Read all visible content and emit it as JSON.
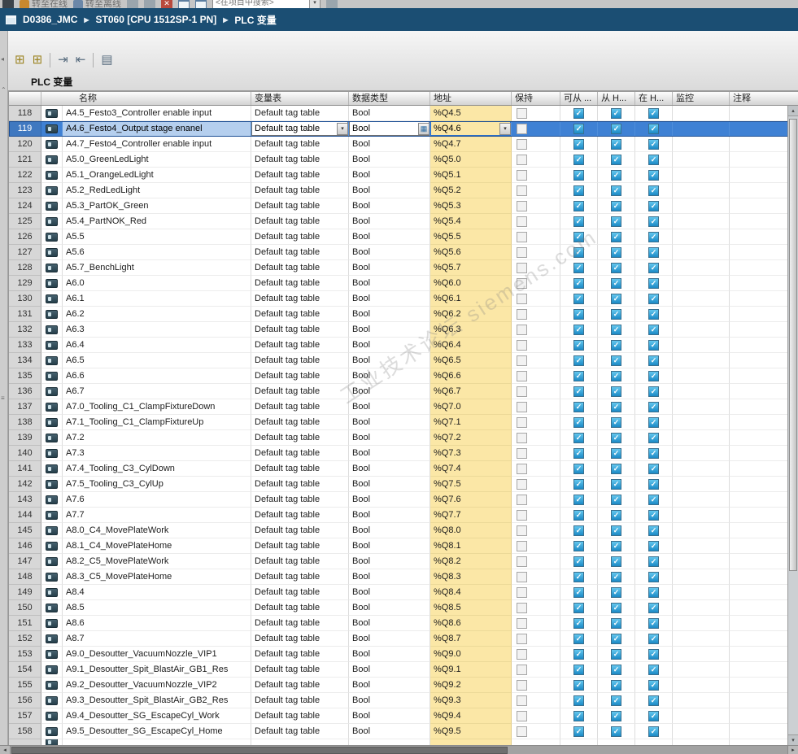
{
  "topbar": {
    "go_online": "转至在线",
    "go_offline": "转至离线",
    "search_placeholder": "<在项目中搜索>"
  },
  "breadcrumb": {
    "project": "D0386_JMC",
    "device": "ST060 [CPU 1512SP-1 PN]",
    "page": "PLC 变量"
  },
  "page": {
    "title": "PLC 变量"
  },
  "watermark": {
    "text": "工业技术论坛 siemens.com"
  },
  "colors": {
    "selection": "#3f81d4",
    "address_bg": "#fbe7a6",
    "checkbox": "#1b8ac6",
    "breadcrumb_bg": "#1b4e73"
  },
  "table": {
    "headers": {
      "name": "名称",
      "tag_table": "变量表",
      "data_type": "数据类型",
      "address": "地址",
      "retain": "保持",
      "acc": "可从 ...",
      "from_hmi": "从 H...",
      "in_hmi": "在 H...",
      "monitor": "监控",
      "comment": "注释"
    },
    "defaults": {
      "tag_table": "Default tag table",
      "data_type": "Bool",
      "retain": false,
      "acc": true,
      "from_hmi": true,
      "in_hmi": true,
      "selected": false,
      "comment": ""
    },
    "rows": [
      {
        "num": 118,
        "name": "A4.5_Festo3_Controller enable input",
        "address": "%Q4.5"
      },
      {
        "num": 119,
        "name": "A4.6_Festo4_Output stage enanel",
        "address": "%Q4.6",
        "selected": true
      },
      {
        "num": 120,
        "name": "A4.7_Festo4_Controller enable input",
        "address": "%Q4.7"
      },
      {
        "num": 121,
        "name": "A5.0_GreenLedLight",
        "address": "%Q5.0"
      },
      {
        "num": 122,
        "name": "A5.1_OrangeLedLight",
        "address": "%Q5.1"
      },
      {
        "num": 123,
        "name": "A5.2_RedLedLight",
        "address": "%Q5.2"
      },
      {
        "num": 124,
        "name": "A5.3_PartOK_Green",
        "address": "%Q5.3"
      },
      {
        "num": 125,
        "name": "A5.4_PartNOK_Red",
        "address": "%Q5.4"
      },
      {
        "num": 126,
        "name": "A5.5",
        "address": "%Q5.5"
      },
      {
        "num": 127,
        "name": "A5.6",
        "address": "%Q5.6"
      },
      {
        "num": 128,
        "name": "A5.7_BenchLight",
        "address": "%Q5.7"
      },
      {
        "num": 129,
        "name": "A6.0",
        "address": "%Q6.0"
      },
      {
        "num": 130,
        "name": "A6.1",
        "address": "%Q6.1"
      },
      {
        "num": 131,
        "name": "A6.2",
        "address": "%Q6.2"
      },
      {
        "num": 132,
        "name": "A6.3",
        "address": "%Q6.3"
      },
      {
        "num": 133,
        "name": "A6.4",
        "address": "%Q6.4"
      },
      {
        "num": 134,
        "name": "A6.5",
        "address": "%Q6.5"
      },
      {
        "num": 135,
        "name": "A6.6",
        "address": "%Q6.6"
      },
      {
        "num": 136,
        "name": "A6.7",
        "address": "%Q6.7"
      },
      {
        "num": 137,
        "name": "A7.0_Tooling_C1_ClampFixtureDown",
        "address": "%Q7.0"
      },
      {
        "num": 138,
        "name": "A7.1_Tooling_C1_ClampFixtureUp",
        "address": "%Q7.1"
      },
      {
        "num": 139,
        "name": "A7.2",
        "address": "%Q7.2"
      },
      {
        "num": 140,
        "name": "A7.3",
        "address": "%Q7.3"
      },
      {
        "num": 141,
        "name": "A7.4_Tooling_C3_CylDown",
        "address": "%Q7.4"
      },
      {
        "num": 142,
        "name": "A7.5_Tooling_C3_CylUp",
        "address": "%Q7.5"
      },
      {
        "num": 143,
        "name": "A7.6",
        "address": "%Q7.6"
      },
      {
        "num": 144,
        "name": "A7.7",
        "address": "%Q7.7"
      },
      {
        "num": 145,
        "name": "A8.0_C4_MovePlateWork",
        "address": "%Q8.0"
      },
      {
        "num": 146,
        "name": "A8.1_C4_MovePlateHome",
        "address": "%Q8.1"
      },
      {
        "num": 147,
        "name": "A8.2_C5_MovePlateWork",
        "address": "%Q8.2"
      },
      {
        "num": 148,
        "name": "A8.3_C5_MovePlateHome",
        "address": "%Q8.3"
      },
      {
        "num": 149,
        "name": "A8.4",
        "address": "%Q8.4"
      },
      {
        "num": 150,
        "name": "A8.5",
        "address": "%Q8.5"
      },
      {
        "num": 151,
        "name": "A8.6",
        "address": "%Q8.6"
      },
      {
        "num": 152,
        "name": "A8.7",
        "address": "%Q8.7"
      },
      {
        "num": 153,
        "name": "A9.0_Desoutter_VacuumNozzle_VIP1",
        "address": "%Q9.0"
      },
      {
        "num": 154,
        "name": "A9.1_Desoutter_Spit_BlastAir_GB1_Res",
        "address": "%Q9.1"
      },
      {
        "num": 155,
        "name": "A9.2_Desoutter_VacuumNozzle_VIP2",
        "address": "%Q9.2"
      },
      {
        "num": 156,
        "name": "A9.3_Desoutter_Spit_BlastAir_GB2_Res",
        "address": "%Q9.3"
      },
      {
        "num": 157,
        "name": "A9.4_Desoutter_SG_EscapeCyl_Work",
        "address": "%Q9.4"
      },
      {
        "num": 158,
        "name": "A9.5_Desoutter_SG_EscapeCyl_Home",
        "address": "%Q9.5"
      }
    ]
  }
}
